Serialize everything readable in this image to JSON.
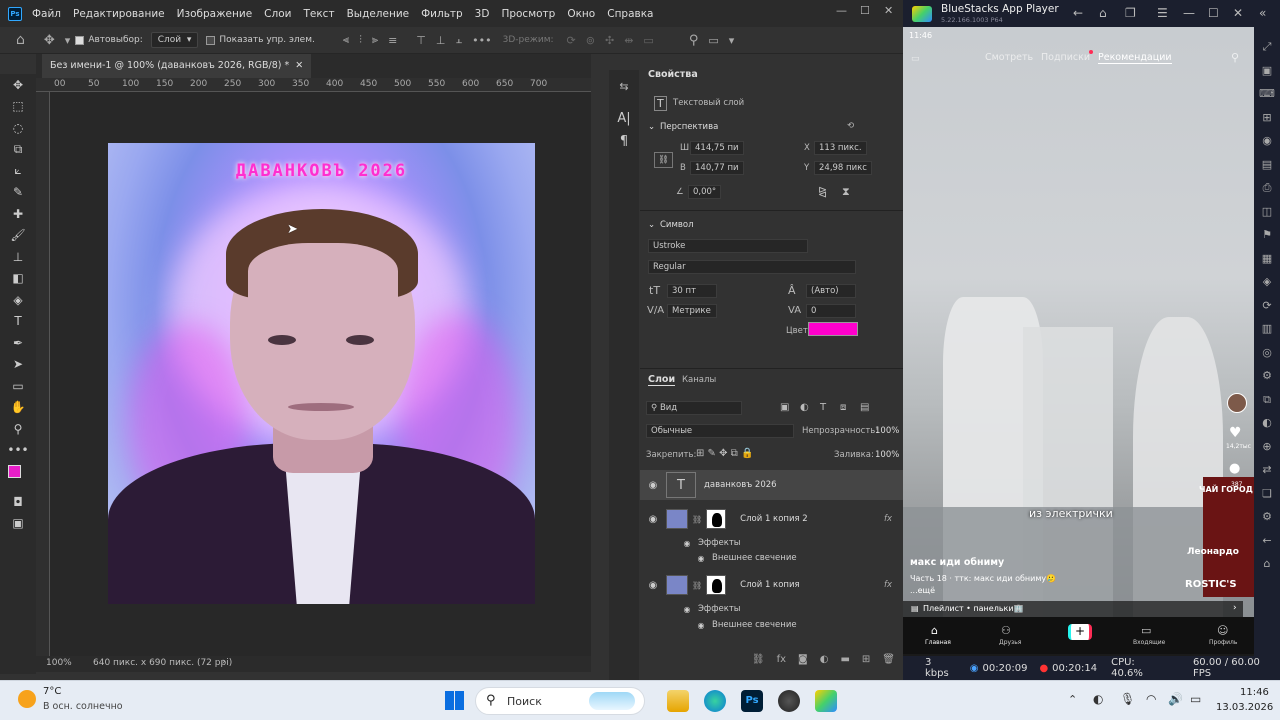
{
  "photoshop": {
    "menu": [
      "Файл",
      "Редактирование",
      "Изображение",
      "Слои",
      "Текст",
      "Выделение",
      "Фильтр",
      "3D",
      "Просмотр",
      "Окно",
      "Справка"
    ],
    "options": {
      "autoselect": "Автовыбор:",
      "autoselect_value": "Слой",
      "show_controls": "Показать упр. элем.",
      "mode_3d": "3D-режим:"
    },
    "doc_tab": "Без имени-1 @ 100% (даванковъ 2026, RGB/8) *",
    "ruler_ticks": [
      "00",
      "50",
      "100",
      "150",
      "200",
      "250",
      "300",
      "350",
      "400",
      "450",
      "500",
      "550",
      "600",
      "650",
      "700"
    ],
    "artwork_text": "ДАВАНКОВЪ 2026",
    "zoom": "100%",
    "doc_info": "640 пикс. x 690 пикс. (72 ppi)",
    "properties": {
      "tab": "Свойства",
      "layer_type": "Текстовый слой",
      "perspective": "Перспектива",
      "w_label": "Ш",
      "w": "414,75 пи",
      "h_label": "В",
      "h": "140,77 пи",
      "x_label": "X",
      "x": "113 пикс.",
      "y_label": "Y",
      "y": "24,98 пикс",
      "angle": "0,00°",
      "symbol": "Символ",
      "font": "Ustroke",
      "style": "Regular",
      "size": "30 пт",
      "leading": "(Авто)",
      "kerning": "Метрике",
      "tracking": "0",
      "color_label": "Цвет",
      "color": "#ff00cc"
    },
    "layers": {
      "tab_layers": "Слои",
      "tab_channels": "Каналы",
      "search": "Вид",
      "blend": "Обычные",
      "opacity_label": "Непрозрачность:",
      "opacity": "100%",
      "lock_label": "Закрепить:",
      "fill_label": "Заливка:",
      "fill": "100%",
      "items": [
        {
          "name": "даванковъ 2026"
        },
        {
          "name": "Слой 1 копия 2",
          "effects": "Эффекты",
          "glow": "Внешнее свечение",
          "fx": "fx"
        },
        {
          "name": "Слой 1 копия",
          "effects": "Эффекты",
          "glow": "Внешнее свечение",
          "fx": "fx"
        }
      ]
    }
  },
  "bluestacks": {
    "title": "BlueStacks App Player",
    "version": "5.22.166.1003  P64",
    "time": "11:46",
    "tabs": [
      "Смотреть",
      "Подписки",
      "Рекомендации"
    ],
    "overlay_text": "из электрички",
    "author": "макс иди обниму",
    "caption": "Часть 18 · ттк: макс иди обниму🥲",
    "more": "...ещё",
    "playlist": "Плейлист • панельки🏢",
    "likes": "14,2тыс",
    "comments": "387",
    "nav": [
      "Главная",
      "Друзья",
      "",
      "Входящие",
      "Профиль"
    ],
    "sign1": "ЧАЙ ГОРОД",
    "sign2": "Леонардо",
    "sign3": "ROSTIC'S",
    "status": {
      "kbps": "3 kbps",
      "t1": "00:20:09",
      "t2": "00:20:14",
      "cpu": "CPU: 40.6%",
      "fps": "60.00 / 60.00 FPS"
    }
  },
  "taskbar": {
    "temp": "7°C",
    "weather": "В осн. солнечно",
    "search": "Поиск",
    "time": "11:46",
    "date": "13.03.2026"
  }
}
